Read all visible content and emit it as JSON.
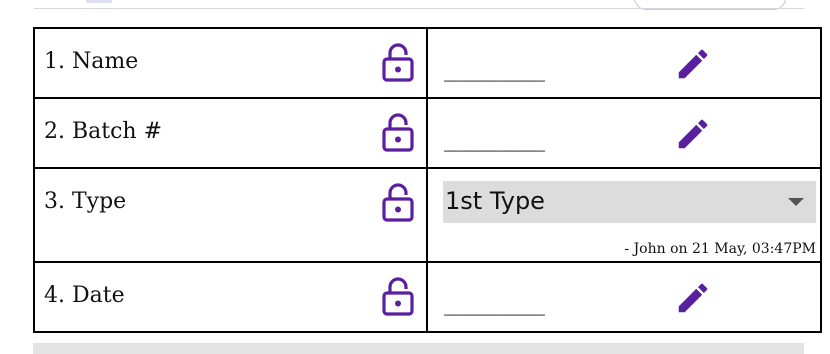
{
  "accent_color": "#5a1f9e",
  "rows": [
    {
      "label": "1. Name",
      "value": "__________",
      "lock_icon": "unlock-icon",
      "edit_icon": "pencil-icon"
    },
    {
      "label": "2. Batch #",
      "value": "__________",
      "lock_icon": "unlock-icon",
      "edit_icon": "pencil-icon"
    },
    {
      "label": "3. Type",
      "select_value": "1st Type",
      "note": "- John on 21 May, 03:47PM",
      "lock_icon": "unlock-icon"
    },
    {
      "label": "4. Date",
      "value": "__________",
      "lock_icon": "unlock-icon",
      "edit_icon": "pencil-icon"
    }
  ]
}
